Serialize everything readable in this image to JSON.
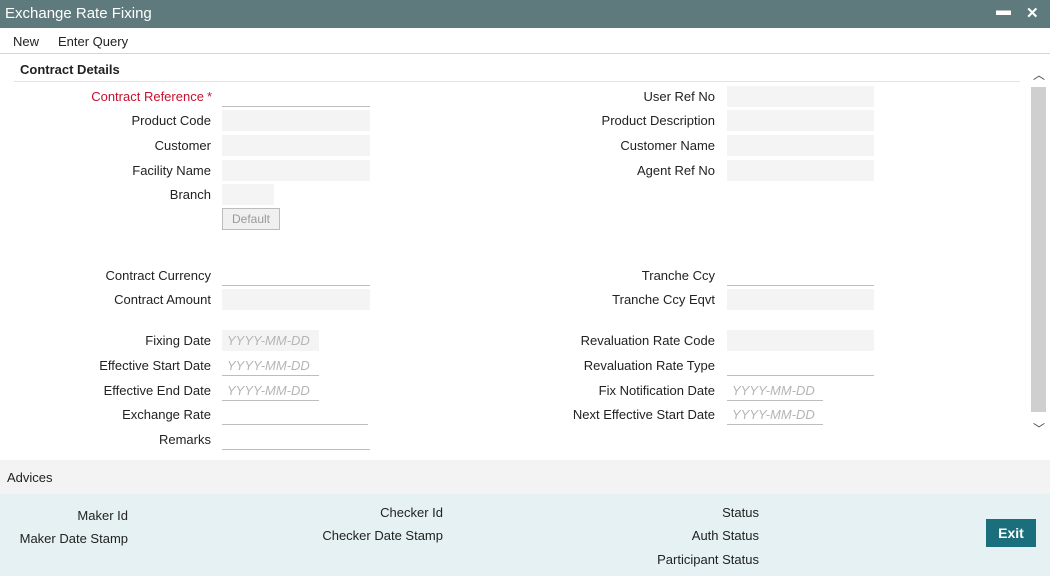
{
  "window": {
    "title": "Exchange Rate Fixing"
  },
  "menu": {
    "new": "New",
    "enter_query": "Enter Query"
  },
  "section": {
    "title": "Contract Details"
  },
  "left_fields": {
    "contract_reference": "Contract Reference",
    "product_code": "Product Code",
    "customer": "Customer",
    "facility_name": "Facility Name",
    "branch": "Branch",
    "default_button": "Default",
    "contract_currency": "Contract Currency",
    "contract_amount": "Contract Amount",
    "fixing_date": "Fixing Date",
    "effective_start_date": "Effective Start Date",
    "effective_end_date": "Effective End Date",
    "exchange_rate": "Exchange Rate",
    "remarks": "Remarks"
  },
  "right_fields": {
    "user_ref_no": "User Ref No",
    "product_description": "Product Description",
    "customer_name": "Customer Name",
    "agent_ref_no": "Agent Ref No",
    "tranche_ccy": "Tranche Ccy",
    "tranche_ccy_eqvt": "Tranche Ccy Eqvt",
    "revaluation_rate_code": "Revaluation Rate Code",
    "revaluation_rate_type": "Revaluation Rate Type",
    "fix_notification_date": "Fix Notification Date",
    "next_effective_start_date": "Next Effective Start Date"
  },
  "date_placeholder": "YYYY-MM-DD",
  "advices": "Advices",
  "footer": {
    "maker_id": "Maker Id",
    "maker_date_stamp": "Maker Date Stamp",
    "checker_id": "Checker Id",
    "checker_date_stamp": "Checker Date Stamp",
    "status": "Status",
    "auth_status": "Auth Status",
    "participant_status": "Participant Status",
    "exit_button": "Exit"
  }
}
